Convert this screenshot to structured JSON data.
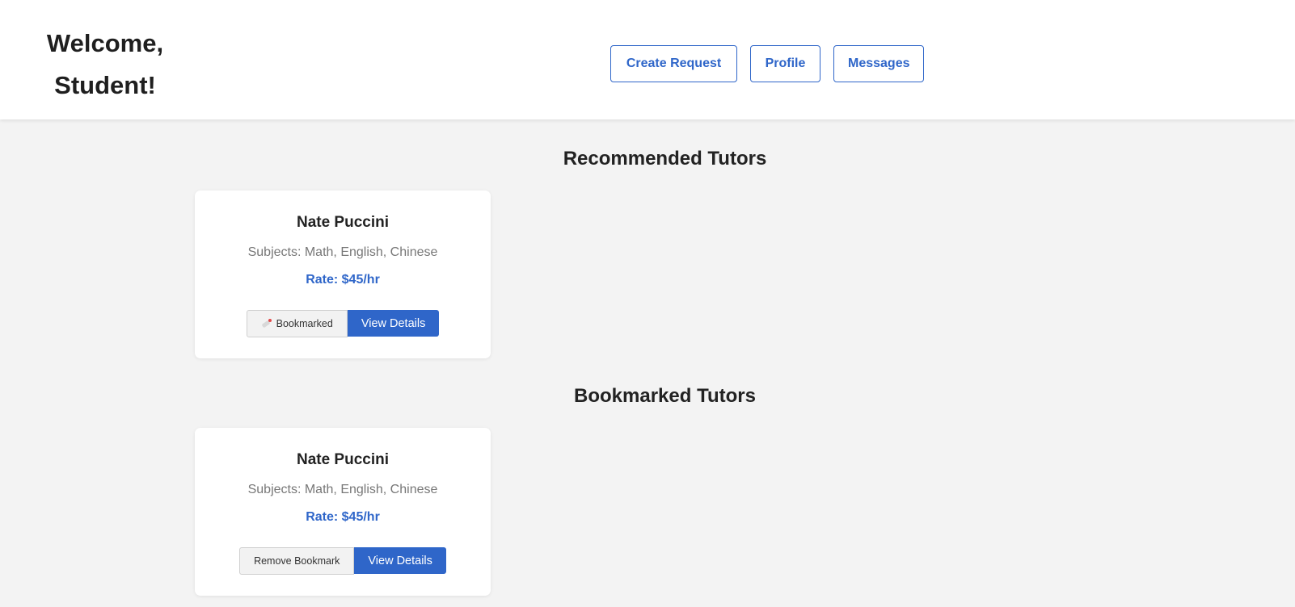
{
  "header": {
    "welcome_line1": "Welcome,",
    "welcome_line2": "Student!",
    "nav": {
      "create_request": "Create Request",
      "profile": "Profile",
      "messages": "Messages"
    }
  },
  "recommended": {
    "title": "Recommended Tutors",
    "tutors": [
      {
        "name": "Nate Puccini",
        "subjects": "Subjects: Math, English, Chinese",
        "rate": "Rate: $45/hr",
        "bookmark_label": "Bookmarked",
        "details_label": "View Details"
      }
    ]
  },
  "bookmarked": {
    "title": "Bookmarked Tutors",
    "tutors": [
      {
        "name": "Nate Puccini",
        "subjects": "Subjects: Math, English, Chinese",
        "rate": "Rate: $45/hr",
        "bookmark_label": "Remove Bookmark",
        "details_label": "View Details"
      }
    ]
  },
  "colors": {
    "accent": "#2f66c9",
    "background": "#f3f3f3",
    "card": "#ffffff"
  },
  "icons": {
    "bookmark": "bookmark-icon"
  }
}
